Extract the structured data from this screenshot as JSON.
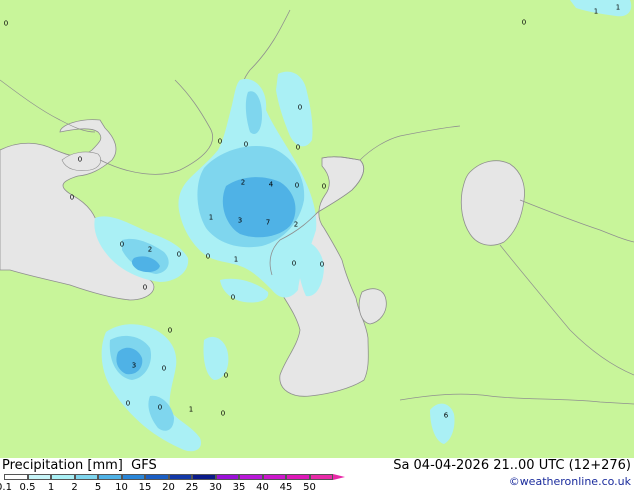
{
  "map": {
    "colors": {
      "land": "#c8f59a",
      "water": "#e6e6e6",
      "coast": "#8f8f8f",
      "light": "#aaf0f5",
      "mid": "#7fd6ee",
      "strong": "#4fb2e6"
    },
    "values": [
      {
        "id": "v0",
        "text": "0"
      },
      {
        "id": "v1",
        "text": "0"
      },
      {
        "id": "v2",
        "text": "1"
      },
      {
        "id": "v3",
        "text": "1"
      },
      {
        "id": "v4",
        "text": "0"
      },
      {
        "id": "v5",
        "text": "0"
      },
      {
        "id": "v6",
        "text": "0"
      },
      {
        "id": "v7",
        "text": "0"
      },
      {
        "id": "v8",
        "text": "0"
      },
      {
        "id": "v9",
        "text": "2"
      },
      {
        "id": "v10",
        "text": "4"
      },
      {
        "id": "v11",
        "text": "0"
      },
      {
        "id": "v12",
        "text": "0"
      },
      {
        "id": "v13",
        "text": "0"
      },
      {
        "id": "v14",
        "text": "1"
      },
      {
        "id": "v15",
        "text": "3"
      },
      {
        "id": "v16",
        "text": "7"
      },
      {
        "id": "v17",
        "text": "2"
      },
      {
        "id": "v18",
        "text": "0"
      },
      {
        "id": "v19",
        "text": "2"
      },
      {
        "id": "v20",
        "text": "0"
      },
      {
        "id": "v21",
        "text": "0"
      },
      {
        "id": "v22",
        "text": "1"
      },
      {
        "id": "v23",
        "text": "0"
      },
      {
        "id": "v24",
        "text": "0"
      },
      {
        "id": "v25",
        "text": "0"
      },
      {
        "id": "v26",
        "text": "0"
      },
      {
        "id": "v27",
        "text": "0"
      },
      {
        "id": "v28",
        "text": "3"
      },
      {
        "id": "v29",
        "text": "0"
      },
      {
        "id": "v30",
        "text": "0"
      },
      {
        "id": "v31",
        "text": "0"
      },
      {
        "id": "v32",
        "text": "0"
      },
      {
        "id": "v33",
        "text": "1"
      },
      {
        "id": "v34",
        "text": "0"
      },
      {
        "id": "v35",
        "text": "6"
      }
    ]
  },
  "footer": {
    "title": "Precipitation [mm]  GFS",
    "run_info": "Sa 04-04-2026 21..00 UTC (12+276)",
    "credit": "©weatheronline.co.uk"
  },
  "legend": {
    "items": [
      {
        "label": "0.1",
        "color": "#ffffff"
      },
      {
        "label": "0.5",
        "color": "#c8f5f8"
      },
      {
        "label": "1",
        "color": "#aaf0f5"
      },
      {
        "label": "2",
        "color": "#7fd6ee"
      },
      {
        "label": "5",
        "color": "#4fb2e6"
      },
      {
        "label": "10",
        "color": "#2a86d8"
      },
      {
        "label": "15",
        "color": "#1a5ec4"
      },
      {
        "label": "20",
        "color": "#1238a8"
      },
      {
        "label": "25",
        "color": "#0a1a8a"
      },
      {
        "label": "30",
        "color": "#9a10d8"
      },
      {
        "label": "35",
        "color": "#b818d8"
      },
      {
        "label": "40",
        "color": "#cc18cc"
      },
      {
        "label": "45",
        "color": "#dd18b8"
      },
      {
        "label": "50",
        "color": "#e82aa8"
      }
    ]
  }
}
